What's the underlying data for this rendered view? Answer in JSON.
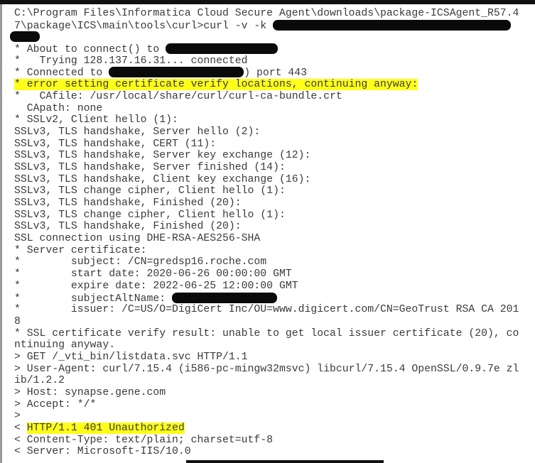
{
  "terminal": {
    "highlight_color": "#ffff1a",
    "lines": [
      [
        {
          "t": "C:\\Program Files\\Informatica Cloud Secure Agent\\downloads\\package-ICSAgent_R57.4"
        }
      ],
      [
        {
          "t": "7\\package\\ICS\\main\\tools\\curl>curl -v -k "
        },
        {
          "redacted": true
        }
      ],
      [
        {
          "redacted": true
        }
      ],
      [
        {
          "t": "* About to connect() to "
        },
        {
          "redacted": true
        }
      ],
      [
        {
          "t": "*   Trying 128.137.16.31... connected"
        }
      ],
      [
        {
          "t": "* Connected to "
        },
        {
          "redacted": true
        },
        {
          "t": ") port 443"
        }
      ],
      [
        {
          "t": "* error setting certificate verify locations, continuing anyway:",
          "hl": true
        }
      ],
      [
        {
          "t": "*   CAfile: /usr/local/share/curl/curl-ca-bundle.crt"
        }
      ],
      [
        {
          "t": "  CApath: none"
        }
      ],
      [
        {
          "t": "* SSLv2, Client hello (1):"
        }
      ],
      [
        {
          "t": "SSLv3, TLS handshake, Server hello (2):"
        }
      ],
      [
        {
          "t": "SSLv3, TLS handshake, CERT (11):"
        }
      ],
      [
        {
          "t": "SSLv3, TLS handshake, Server key exchange (12):"
        }
      ],
      [
        {
          "t": "SSLv3, TLS handshake, Server finished (14):"
        }
      ],
      [
        {
          "t": "SSLv3, TLS handshake, Client key exchange (16):"
        }
      ],
      [
        {
          "t": "SSLv3, TLS change cipher, Client hello (1):"
        }
      ],
      [
        {
          "t": "SSLv3, TLS handshake, Finished (20):"
        }
      ],
      [
        {
          "t": "SSLv3, TLS change cipher, Client hello (1):"
        }
      ],
      [
        {
          "t": "SSLv3, TLS handshake, Finished (20):"
        }
      ],
      [
        {
          "t": "SSL connection using DHE-RSA-AES256-SHA"
        }
      ],
      [
        {
          "t": "* Server certificate:"
        }
      ],
      [
        {
          "t": "*        subject: /CN=gredsp16.roche.com"
        }
      ],
      [
        {
          "t": "*        start date: 2020-06-26 00:00:00 GMT"
        }
      ],
      [
        {
          "t": "*        expire date: 2022-06-25 12:00:00 GMT"
        }
      ],
      [
        {
          "t": "*        subjectAltName: "
        },
        {
          "redacted": true
        }
      ],
      [
        {
          "t": "*        issuer: /C=US/O=DigiCert Inc/OU=www.digicert.com/CN=GeoTrust RSA CA 201"
        }
      ],
      [
        {
          "t": "8"
        }
      ],
      [
        {
          "t": "* SSL certificate verify result: unable to get local issuer certificate (20), co"
        }
      ],
      [
        {
          "t": "ntinuing anyway."
        }
      ],
      [
        {
          "t": "> GET /_vti_bin/listdata.svc HTTP/1.1"
        }
      ],
      [
        {
          "t": "> User-Agent: curl/7.15.4 (i586-pc-mingw32msvc) libcurl/7.15.4 OpenSSL/0.9.7e zl"
        }
      ],
      [
        {
          "t": "ib/1.2.2"
        }
      ],
      [
        {
          "t": "> Host: synapse.gene.com"
        }
      ],
      [
        {
          "t": "> Accept: */*"
        }
      ],
      [
        {
          "t": ">"
        }
      ],
      [
        {
          "t": "< "
        },
        {
          "t": "HTTP/1.1 401 Unauthorized",
          "hl": true
        }
      ],
      [
        {
          "t": "< Content-Type: text/plain; charset=utf-8"
        }
      ],
      [
        {
          "t": "< Server: Microsoft-IIS/10.0"
        }
      ]
    ]
  }
}
